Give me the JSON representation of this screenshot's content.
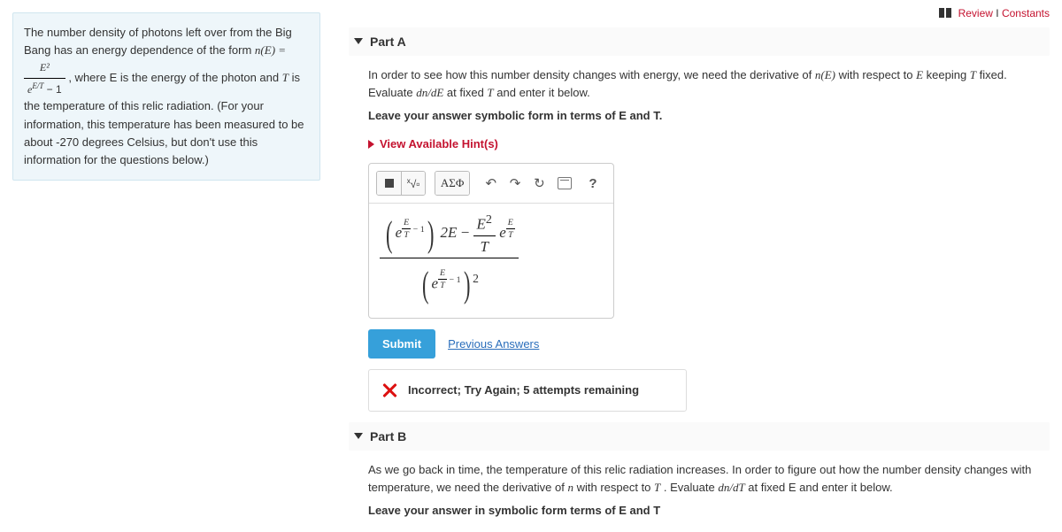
{
  "top": {
    "review": "Review",
    "constants": "Constants"
  },
  "intro": {
    "text_a": "The number density of photons left over from the Big Bang has an energy dependence of the form ",
    "formula_lhs": "n(E) = ",
    "num": "E²",
    "den_a": "e",
    "den_exp": "E/T",
    "den_b": " − 1",
    "text_b": ", where E is the energy of the photon and ",
    "Tvar": "T",
    "text_c": " is the temperature of this relic radiation. (For your information, this temperature has been measured to be about -270 degrees Celsius, but don't use this information for the questions below.)"
  },
  "partA": {
    "title": "Part A",
    "prompt_a": "In order to see how this number density changes with energy, we need the derivative of ",
    "nE": "n(E)",
    "prompt_b": " with respect to ",
    "E": "E",
    "prompt_c": " keeping ",
    "T": "T",
    "prompt_d": " fixed. Evaluate ",
    "dndE": "dn/dE",
    "prompt_e": " at fixed ",
    "prompt_f": " and enter it below.",
    "leave": "Leave your answer symbolic form in terms of E and T.",
    "hints": "View Available Hint(s)",
    "toolbar": {
      "templates": "ΑΣΦ",
      "help": "?"
    },
    "answer": {
      "p1_exp_num": "E",
      "p1_exp_den": "T",
      "p1_minus1": " − 1",
      "twoE": "2E",
      "E2": "E",
      "E2sup": "2",
      "Tden": "T",
      "p2_exp_num": "E",
      "p2_exp_den": "T",
      "d_exp_num": "E",
      "d_exp_den": "T",
      "d_minus1": " − 1",
      "d_sq": "2",
      "e": "e"
    },
    "submit": "Submit",
    "previous": "Previous Answers",
    "feedback": "Incorrect; Try Again; 5 attempts remaining"
  },
  "partB": {
    "title": "Part B",
    "prompt_a": "As we go back in time, the temperature of this relic radiation increases. In order to figure out how the number density changes with temperature, we need the derivative of ",
    "n": "n",
    "prompt_b": " with respect to ",
    "T": "T",
    "prompt_c": ". Evaluate ",
    "dndT": "dn/dT",
    "prompt_d": " at fixed E and enter it below.",
    "leave": "Leave your answer in symbolic form terms of E and T"
  }
}
